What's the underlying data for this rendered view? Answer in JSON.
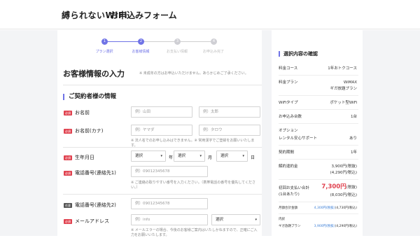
{
  "header": {
    "logo": "縛られないWiFi",
    "title": "お申込みフォーム"
  },
  "steps": [
    {
      "num": "1",
      "label": "プラン選択",
      "active": true
    },
    {
      "num": "2",
      "label": "お客様情報",
      "active": true
    },
    {
      "num": "3",
      "label": "お支払い情報",
      "active": false
    },
    {
      "num": "4",
      "label": "お申込み完了",
      "active": false
    }
  ],
  "section": {
    "title": "お客様情報の入力",
    "note": "※ 未成年の方はお申込いただけません。あらかじめご了承ください。",
    "subtitle": "ご契約者様の情報"
  },
  "badges": {
    "required": "必須",
    "optional": "任意"
  },
  "fields": {
    "name": {
      "label": "お名前",
      "last_placeholder": "例）山田",
      "first_placeholder": "例）太郎"
    },
    "kana": {
      "label": "お名前(カナ)",
      "last_placeholder": "例）ヤマダ",
      "first_placeholder": "例）タロウ",
      "note": "※ 法人名でのお申し込みはできません。※ 常用漢字でご登録をお願いいたします。"
    },
    "birth": {
      "label": "生年月日",
      "year": "選択",
      "year_unit": "年",
      "month": "選択",
      "month_unit": "月",
      "day": "選択",
      "day_unit": "日"
    },
    "phone1": {
      "label": "電話番号(連絡先1)",
      "placeholder": "例）09012345678",
      "note": "※ ご連絡の取りやすい番号を入力ください。（携帯電話の番号を優先してください。）"
    },
    "phone2": {
      "label": "電話番号(連絡先2)",
      "placeholder": "例）09012345678"
    },
    "email": {
      "label": "メールアドレス",
      "placeholder": "例）info",
      "domain_select": "選択",
      "note": "※ メールエラーの場合、今後のお客様ご案内はいたしかねますので、正確にご入力をお願いいたします。"
    }
  },
  "sidebar": {
    "title": "選択内容の確認",
    "rows": [
      {
        "label": "料金コース",
        "value": "1年おトクコース"
      },
      {
        "label": "料金プラン",
        "value": "WiMAX",
        "value2": "ギガ放題プラン"
      },
      {
        "label": "WiFiタイプ",
        "value": "ポケット型WiFi"
      },
      {
        "label": "お申込み台数",
        "value": "1台"
      },
      {
        "label": "オプション",
        "label2": "レンタル安心サポート",
        "value": "あり"
      },
      {
        "label": "契約期間",
        "value": "1年"
      },
      {
        "label": "解約違約金",
        "value": "3,900円(税抜)",
        "value2": "(4,290円/税込)"
      }
    ],
    "initial": {
      "label": "初回お支払い合計",
      "label2": "(1台あたり)",
      "value": "7,300円",
      "suffix": "(税抜)",
      "value2": "(8,030円/税込)"
    },
    "monthly": {
      "label": "月額合計金額",
      "value": "4,300円(税抜)",
      "value2": "(4,730円/税込)"
    },
    "breakdown": {
      "label": "内訳",
      "plan_label": "ギガ放題プラン",
      "plan_value": "3,900円(税抜)",
      "plan_value2": "(4,290円/税込)"
    }
  }
}
